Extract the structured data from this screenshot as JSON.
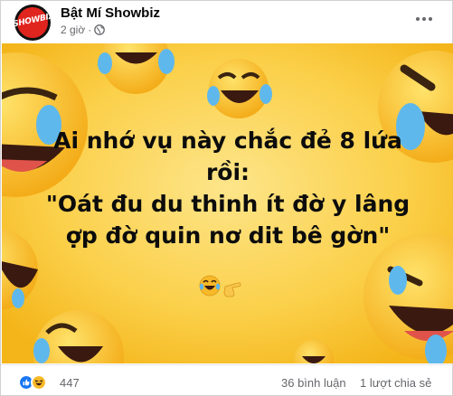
{
  "post": {
    "page_name": "Bật Mí Showbiz",
    "avatar_text": "SHOWBIZ",
    "time": "2 giờ",
    "separator": "·",
    "privacy_icon": "globe-icon",
    "more_icon": "more-horizontal-icon"
  },
  "image": {
    "caption_lines": [
      "Ai nhớ vụ này chắc đẻ 8 lứa",
      "rồi:",
      "\"Oát đu du thinh ít đờ y lâng",
      "ợp đờ quin nơ dit bê gờn\""
    ],
    "caption_emojis": [
      "laughing-crying-emoji",
      "pointing-hand-emoji"
    ],
    "background_color": "#f9c21d",
    "background_pattern": "laughing-crying-emoji"
  },
  "footer": {
    "reaction_icons": [
      "like-reaction-icon",
      "haha-reaction-icon"
    ],
    "reaction_count": "447",
    "comments": "36 bình luận",
    "shares": "1 lượt chia sẻ"
  },
  "colors": {
    "like_blue": "#1877f2",
    "haha_yellow": "#f7b928",
    "muted_text": "#65676b"
  }
}
